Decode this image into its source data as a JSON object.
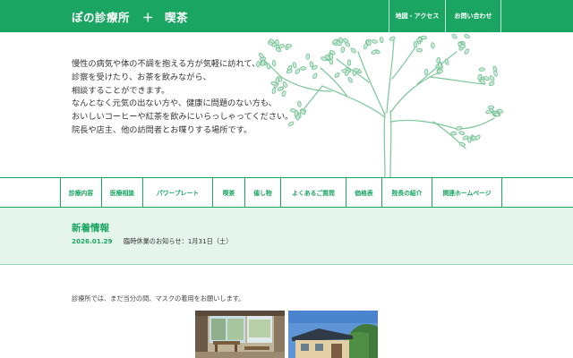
{
  "header": {
    "title_left": "ぽの診療所",
    "title_plus": "＋",
    "title_right": "喫茶",
    "links": [
      {
        "label": "地図・アクセス"
      },
      {
        "label": "お問い合わせ"
      }
    ]
  },
  "hero": {
    "intro_lines": [
      "慢性の病気や体の不調を抱える方が気軽に訪れて、",
      "診察を受けたり、お茶を飲みながら、",
      "相談することができます。",
      "なんとなく元気の出ない方や、健康に問題のない方も、",
      "おいしいコーヒーや紅茶を飲みにいらっしゃってください。",
      "院長や店主、他の訪問者とお喋りする場所です。"
    ],
    "tree_icon": "tree-illustration"
  },
  "nav": {
    "items": [
      {
        "label": "診療内容"
      },
      {
        "label": "医療相談"
      },
      {
        "label": "パワープレート"
      },
      {
        "label": "喫茶"
      },
      {
        "label": "催し物"
      },
      {
        "label": "よくあるご質問"
      },
      {
        "label": "価格表"
      },
      {
        "label": "院長の紹介"
      },
      {
        "label": "関連ホームページ"
      }
    ]
  },
  "news": {
    "heading": "新着情報",
    "items": [
      {
        "date": "2026.01.29",
        "text": "臨時休業のお知らせ：1月31日（土）"
      }
    ]
  },
  "main": {
    "notice": "診療所では、まだ当分の間、マスクの着用をお願いします。",
    "photos": [
      {
        "icon": "cafe-interior-photo"
      },
      {
        "icon": "building-exterior-photo"
      }
    ]
  },
  "colors": {
    "brand": "#1aa562",
    "news_bg": "#e6f5ec",
    "tree_stroke": "#7cc69a",
    "leaf_fill": "#cfe9d9"
  }
}
